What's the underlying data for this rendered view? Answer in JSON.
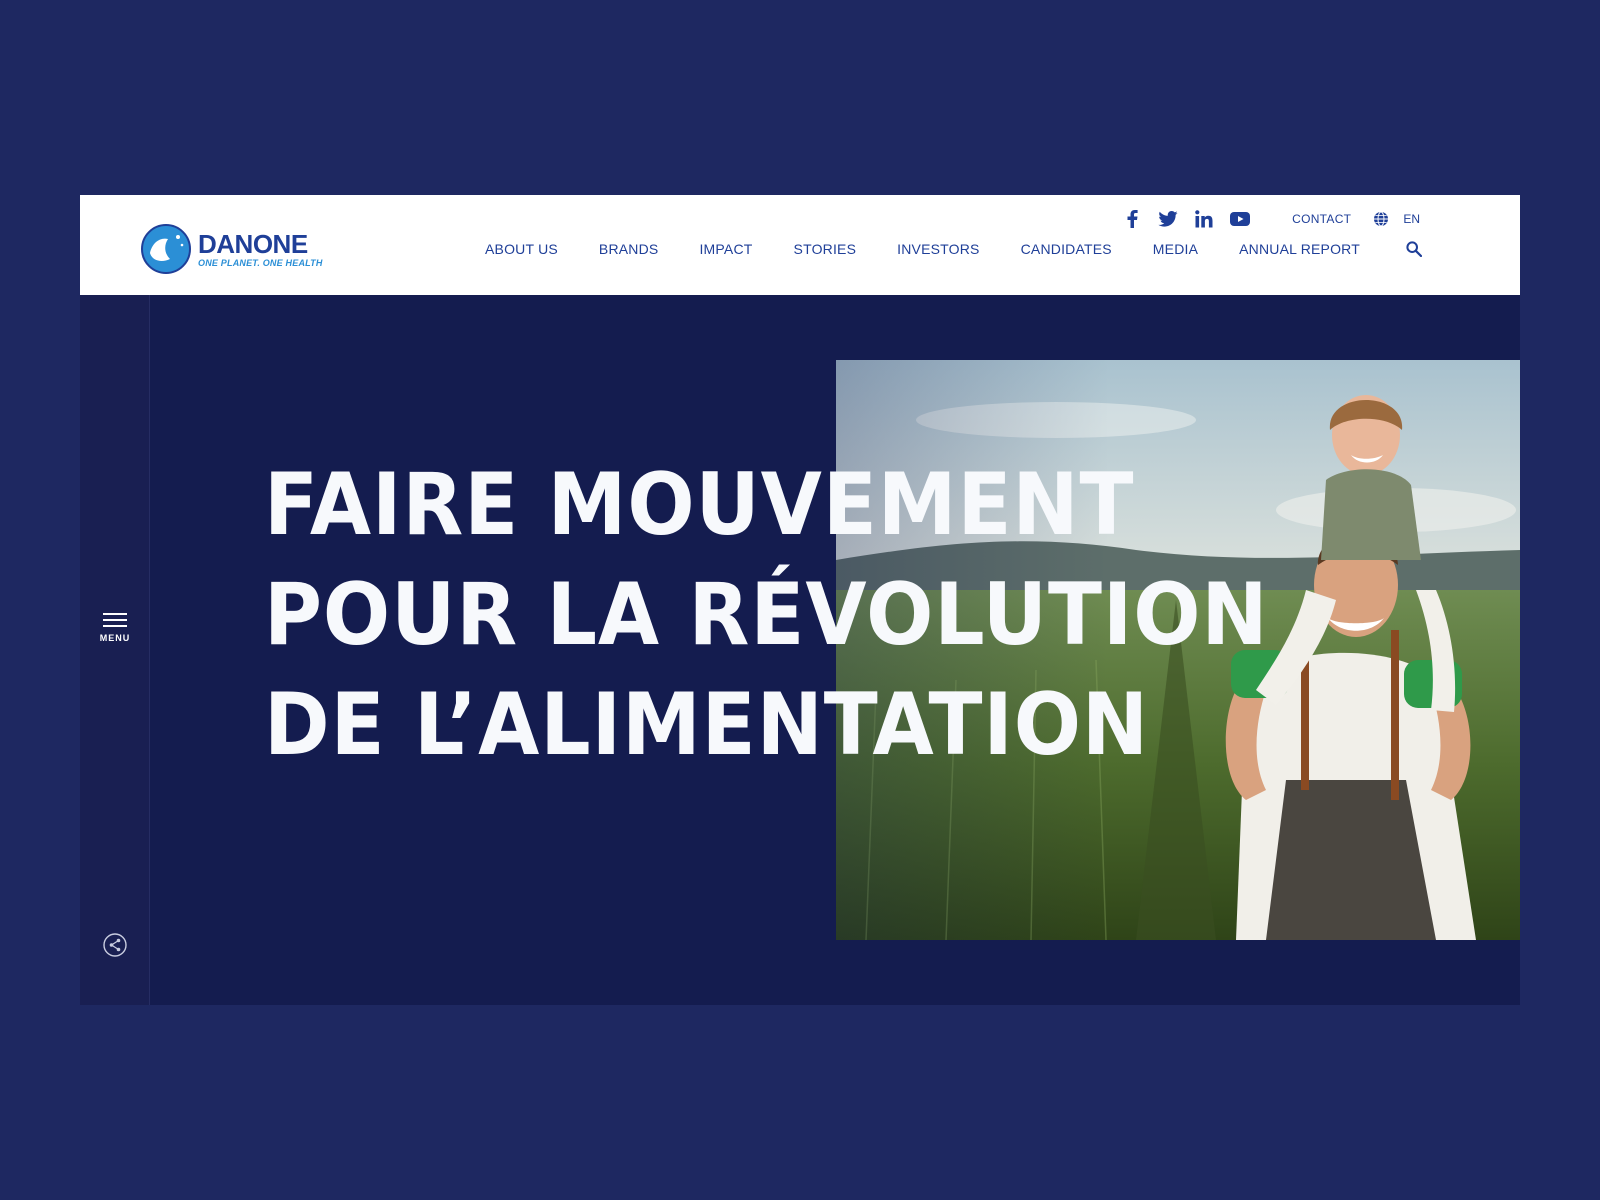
{
  "brand": {
    "name": "DANONE",
    "tagline": "ONE PLANET. ONE HEALTH"
  },
  "header": {
    "top_links": {
      "contact": "CONTACT",
      "language": "EN"
    },
    "social": [
      "facebook-icon",
      "twitter-icon",
      "linkedin-icon",
      "youtube-icon"
    ],
    "nav": [
      {
        "label": "ABOUT US"
      },
      {
        "label": "BRANDS"
      },
      {
        "label": "IMPACT"
      },
      {
        "label": "STORIES"
      },
      {
        "label": "INVESTORS"
      },
      {
        "label": "CANDIDATES"
      },
      {
        "label": "MEDIA"
      },
      {
        "label": "ANNUAL REPORT"
      }
    ]
  },
  "sidebar": {
    "menu_label": "MENU"
  },
  "hero": {
    "headline": [
      "FAIRE MOUVEMENT",
      "POUR LA RÉVOLUTION",
      "DE L’ALIMENTATION"
    ]
  },
  "colors": {
    "page_background": "#1e2861",
    "hero_background": "#141c4f",
    "brand_blue": "#1f3f98",
    "accent_blue": "#2b8fd6",
    "headline_text": "#f7f9fc"
  }
}
